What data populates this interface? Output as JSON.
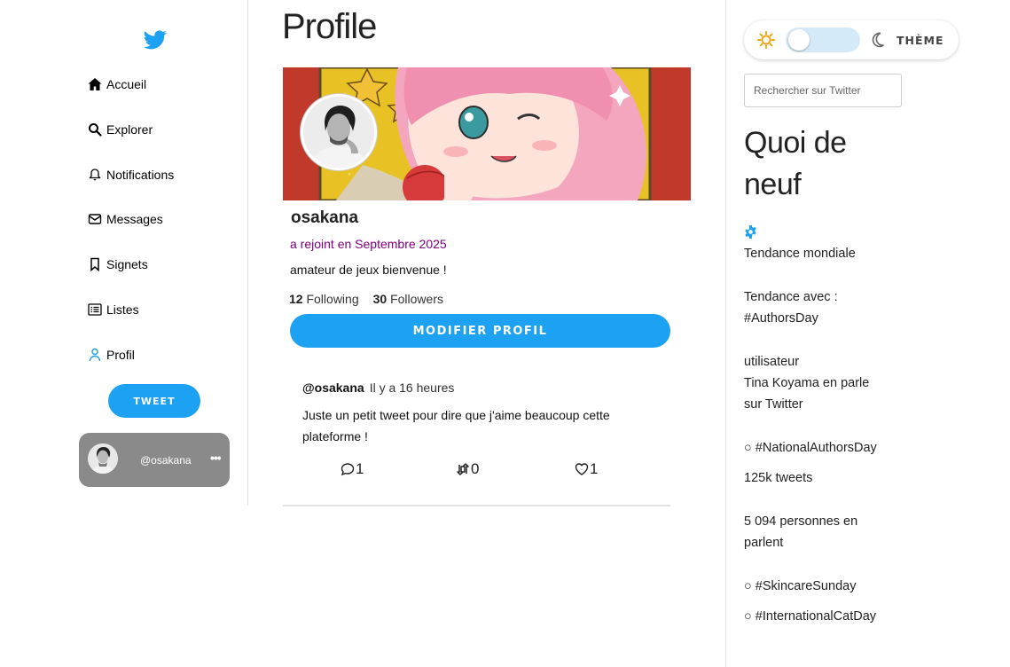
{
  "sidebar": {
    "logo_icon": "twitter-bird-icon",
    "items": [
      {
        "label": "Accueil",
        "icon": "home-icon"
      },
      {
        "label": "Explorer",
        "icon": "search-icon"
      },
      {
        "label": "Notifications",
        "icon": "bell-icon"
      },
      {
        "label": "Messages",
        "icon": "envelope-icon"
      },
      {
        "label": "Signets",
        "icon": "bookmark-icon"
      },
      {
        "label": "Listes",
        "icon": "list-icon"
      },
      {
        "label": "Profil",
        "icon": "user-icon"
      }
    ],
    "tweet_button": "TWEET",
    "user": {
      "handle": "@osakana",
      "more": "•••"
    }
  },
  "main": {
    "title": "Profile",
    "profile": {
      "username": "osakana",
      "joined": "a rejoint en Septembre 2025",
      "bio": "amateur de jeux bienvenue !",
      "following_count": "12",
      "following_label": "Following",
      "followers_count": "30",
      "followers_label": "Followers",
      "edit_button": "MODIFIER PROFIL"
    },
    "tweet": {
      "handle": "@osakana",
      "time": "Il y a 16 heures",
      "text": "Juste un petit tweet pour dire que j'aime beaucoup cette plateforme !",
      "replies": "1",
      "retweets": "0",
      "likes": "1"
    }
  },
  "right": {
    "theme_label": "THÈME",
    "search_placeholder": "Rechercher sur Twitter",
    "news_title": "Quoi de neuf",
    "trend_header": "Tendance mondiale",
    "trend_with_label": "Tendance avec :",
    "trend_with_tag": "#AuthorsDay",
    "user_label": "utilisateur",
    "user_text": "Tina Koyama en parle sur Twitter",
    "trends": [
      {
        "tag": "○  #NationalAuthorsDay"
      },
      {
        "tag": "○  #SkincareSunday"
      },
      {
        "tag": "○  #InternationalCatDay"
      }
    ],
    "tweets_count": "125k tweets",
    "people_count": "5 094 personnes en parlent"
  },
  "colors": {
    "accent": "#1da1f2",
    "joined": "#800080",
    "user_card": "#8a8a8a"
  }
}
